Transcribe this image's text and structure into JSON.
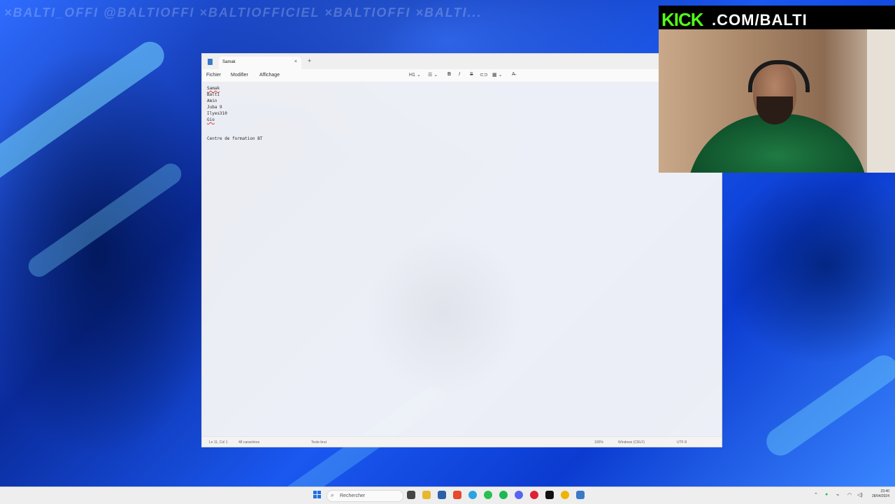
{
  "desktop": {
    "watermark": "×BALTI_OFFI  @BALTIOFFI  ×BALTIOFFICIEL  ×BALTIOFFI  ×BALTI..."
  },
  "notepad": {
    "tab_title": "Samak",
    "tab_close": "×",
    "tab_add": "+",
    "menu": [
      "Fichier",
      "Modifier",
      "Affichage"
    ],
    "toolbar": {
      "heading": "H1",
      "bold": "B",
      "italic": "I",
      "strike": "S"
    },
    "lines": [
      "Samak",
      "Balti",
      "Amin",
      "Juba 9",
      "Ilyes310",
      "Gio",
      "",
      "",
      "Centre de formation BT"
    ],
    "status": {
      "position": "Ln 11, Col 1",
      "chars": "48 caractères",
      "format": "Texte brut",
      "zoom": "100%",
      "line_ending": "Windows (CRLF)",
      "encoding": "UTF-8"
    }
  },
  "webcam": {
    "kick": "KICK",
    "handle": ".COM/BALTI"
  },
  "taskbar": {
    "search_placeholder": "Rechercher",
    "time": "23:40",
    "date": "28/04/2024"
  }
}
